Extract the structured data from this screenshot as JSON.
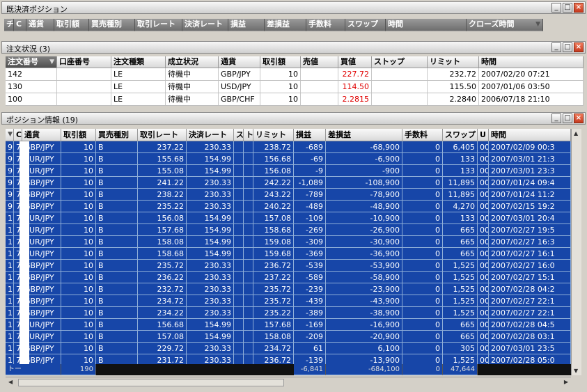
{
  "unsettled": {
    "title": "既決済ポジション",
    "columns": [
      "チ",
      "C",
      "通貨",
      "取引額",
      "買売種別",
      "取引レート",
      "決済レート",
      "損益",
      "差損益",
      "手数料",
      "スワップ",
      "時間",
      "クローズ時間"
    ]
  },
  "orders": {
    "title": "注文状況 (3)",
    "columns": [
      "注文番号",
      "口座番号",
      "注文種類",
      "成立状況",
      "通貨",
      "取引額",
      "売値",
      "買値",
      "ストップ",
      "リミット",
      "時間"
    ],
    "rows": [
      {
        "id": "142",
        "account": "",
        "type": "LE",
        "status": "待機中",
        "pair": "GBP/JPY",
        "amount": "10",
        "sell": "",
        "buy": "227.72",
        "stop": "",
        "limit": "232.72",
        "time": "2007/02/20 07:21"
      },
      {
        "id": "130",
        "account": "",
        "type": "LE",
        "status": "待機中",
        "pair": "USD/JPY",
        "amount": "10",
        "sell": "",
        "buy": "114.50",
        "stop": "",
        "limit": "115.50",
        "time": "2007/01/06 03:50"
      },
      {
        "id": "100",
        "account": "",
        "type": "LE",
        "status": "待機中",
        "pair": "GBP/CHF",
        "amount": "10",
        "sell": "",
        "buy": "2.2815",
        "stop": "",
        "limit": "2.2840",
        "time": "2006/07/18 21:10"
      }
    ]
  },
  "positions": {
    "title": "ポジション情報 (19)",
    "columns": [
      "",
      "C",
      "通貨",
      "取引額",
      "買売種別",
      "取引レート",
      "決済レート",
      "ス",
      "ト",
      "リミット",
      "損益",
      "差損益",
      "手数料",
      "スワップ",
      "U",
      "時間"
    ],
    "rows": [
      {
        "n": "9",
        "c": "7",
        "pair": "GBP/JPY",
        "amt": "10",
        "bs": "B",
        "rate": "237.22",
        "close": "230.33",
        "limit": "238.72",
        "pl": "-689",
        "dpl": "-68,900",
        "fee": "0",
        "swap": "6,405",
        "u": "00",
        "time": "2007/02/09 00:3"
      },
      {
        "n": "9",
        "c": "7",
        "pair": "EUR/JPY",
        "amt": "10",
        "bs": "B",
        "rate": "155.68",
        "close": "154.99",
        "limit": "156.68",
        "pl": "-69",
        "dpl": "-6,900",
        "fee": "0",
        "swap": "133",
        "u": "00",
        "time": "2007/03/01 21:3"
      },
      {
        "n": "9",
        "c": "7",
        "pair": "EUR/JPY",
        "amt": "10",
        "bs": "B",
        "rate": "155.08",
        "close": "154.99",
        "limit": "156.08",
        "pl": "-9",
        "dpl": "-900",
        "fee": "0",
        "swap": "133",
        "u": "00",
        "time": "2007/03/01 23:3"
      },
      {
        "n": "9",
        "c": "7",
        "pair": "GBP/JPY",
        "amt": "10",
        "bs": "B",
        "rate": "241.22",
        "close": "230.33",
        "limit": "242.22",
        "pl": "-1,089",
        "dpl": "-108,900",
        "fee": "0",
        "swap": "11,895",
        "u": "00",
        "time": "2007/01/24 09:4"
      },
      {
        "n": "9",
        "c": "7",
        "pair": "GBP/JPY",
        "amt": "10",
        "bs": "B",
        "rate": "238.22",
        "close": "230.33",
        "limit": "243.22",
        "pl": "-789",
        "dpl": "-78,900",
        "fee": "0",
        "swap": "11,895",
        "u": "00",
        "time": "2007/01/24 11:2"
      },
      {
        "n": "9",
        "c": "7",
        "pair": "GBP/JPY",
        "amt": "10",
        "bs": "B",
        "rate": "235.22",
        "close": "230.33",
        "limit": "240.22",
        "pl": "-489",
        "dpl": "-48,900",
        "fee": "0",
        "swap": "4,270",
        "u": "00",
        "time": "2007/02/15 19:2"
      },
      {
        "n": "1",
        "c": "7",
        "pair": "EUR/JPY",
        "amt": "10",
        "bs": "B",
        "rate": "156.08",
        "close": "154.99",
        "limit": "157.08",
        "pl": "-109",
        "dpl": "-10,900",
        "fee": "0",
        "swap": "133",
        "u": "00",
        "time": "2007/03/01 20:4"
      },
      {
        "n": "1",
        "c": "7",
        "pair": "EUR/JPY",
        "amt": "10",
        "bs": "B",
        "rate": "157.68",
        "close": "154.99",
        "limit": "158.68",
        "pl": "-269",
        "dpl": "-26,900",
        "fee": "0",
        "swap": "665",
        "u": "00",
        "time": "2007/02/27 19:5"
      },
      {
        "n": "1",
        "c": "7",
        "pair": "EUR/JPY",
        "amt": "10",
        "bs": "B",
        "rate": "158.08",
        "close": "154.99",
        "limit": "159.08",
        "pl": "-309",
        "dpl": "-30,900",
        "fee": "0",
        "swap": "665",
        "u": "00",
        "time": "2007/02/27 16:3"
      },
      {
        "n": "1",
        "c": "7",
        "pair": "EUR/JPY",
        "amt": "10",
        "bs": "B",
        "rate": "158.68",
        "close": "154.99",
        "limit": "159.68",
        "pl": "-369",
        "dpl": "-36,900",
        "fee": "0",
        "swap": "665",
        "u": "00",
        "time": "2007/02/27 16:1"
      },
      {
        "n": "1",
        "c": "7",
        "pair": "GBP/JPY",
        "amt": "10",
        "bs": "B",
        "rate": "235.72",
        "close": "230.33",
        "limit": "236.72",
        "pl": "-539",
        "dpl": "-53,900",
        "fee": "0",
        "swap": "1,525",
        "u": "00",
        "time": "2007/02/27 16:0"
      },
      {
        "n": "1",
        "c": "7",
        "pair": "GBP/JPY",
        "amt": "10",
        "bs": "B",
        "rate": "236.22",
        "close": "230.33",
        "limit": "237.22",
        "pl": "-589",
        "dpl": "-58,900",
        "fee": "0",
        "swap": "1,525",
        "u": "00",
        "time": "2007/02/27 15:1"
      },
      {
        "n": "1",
        "c": "7",
        "pair": "GBP/JPY",
        "amt": "10",
        "bs": "B",
        "rate": "232.72",
        "close": "230.33",
        "limit": "235.72",
        "pl": "-239",
        "dpl": "-23,900",
        "fee": "0",
        "swap": "1,525",
        "u": "00",
        "time": "2007/02/28 04:2"
      },
      {
        "n": "1",
        "c": "7",
        "pair": "GBP/JPY",
        "amt": "10",
        "bs": "B",
        "rate": "234.72",
        "close": "230.33",
        "limit": "235.72",
        "pl": "-439",
        "dpl": "-43,900",
        "fee": "0",
        "swap": "1,525",
        "u": "00",
        "time": "2007/02/27 22:1"
      },
      {
        "n": "1",
        "c": "7",
        "pair": "GBP/JPY",
        "amt": "10",
        "bs": "B",
        "rate": "234.22",
        "close": "230.33",
        "limit": "235.22",
        "pl": "-389",
        "dpl": "-38,900",
        "fee": "0",
        "swap": "1,525",
        "u": "00",
        "time": "2007/02/27 22:1"
      },
      {
        "n": "1",
        "c": "7",
        "pair": "EUR/JPY",
        "amt": "10",
        "bs": "B",
        "rate": "156.68",
        "close": "154.99",
        "limit": "157.68",
        "pl": "-169",
        "dpl": "-16,900",
        "fee": "0",
        "swap": "665",
        "u": "00",
        "time": "2007/02/28 04:5"
      },
      {
        "n": "1",
        "c": "7",
        "pair": "EUR/JPY",
        "amt": "10",
        "bs": "B",
        "rate": "157.08",
        "close": "154.99",
        "limit": "158.08",
        "pl": "-209",
        "dpl": "-20,900",
        "fee": "0",
        "swap": "665",
        "u": "00",
        "time": "2007/02/28 03:1"
      },
      {
        "n": "1",
        "c": "7",
        "pair": "GBP/JPY",
        "amt": "10",
        "bs": "B",
        "rate": "229.72",
        "close": "230.33",
        "limit": "234.72",
        "pl": "61",
        "dpl": "6,100",
        "fee": "0",
        "swap": "305",
        "u": "00",
        "time": "2007/03/01 23:5"
      },
      {
        "n": "1",
        "c": "7",
        "pair": "GBP/JPY",
        "amt": "10",
        "bs": "B",
        "rate": "231.72",
        "close": "230.33",
        "limit": "236.72",
        "pl": "-139",
        "dpl": "-13,900",
        "fee": "0",
        "swap": "1,525",
        "u": "00",
        "time": "2007/02/28 05:0"
      }
    ],
    "totals": {
      "label": "トー",
      "amount": "190",
      "pl": "-6,841",
      "dpl": "-684,100",
      "fee": "0",
      "swap": "47,644"
    }
  },
  "window_buttons": {
    "minimize": "_",
    "maximize": "□",
    "close": "×"
  },
  "icons": {
    "sort": "sort-arrow-icon",
    "scroll_up": "▲",
    "scroll_down": "▼",
    "scroll_left": "◀",
    "scroll_right": "▶"
  },
  "colors": {
    "grid_bg": "#1746a8",
    "grid_line": "#8eaed8",
    "negative_price": "#e00000"
  }
}
